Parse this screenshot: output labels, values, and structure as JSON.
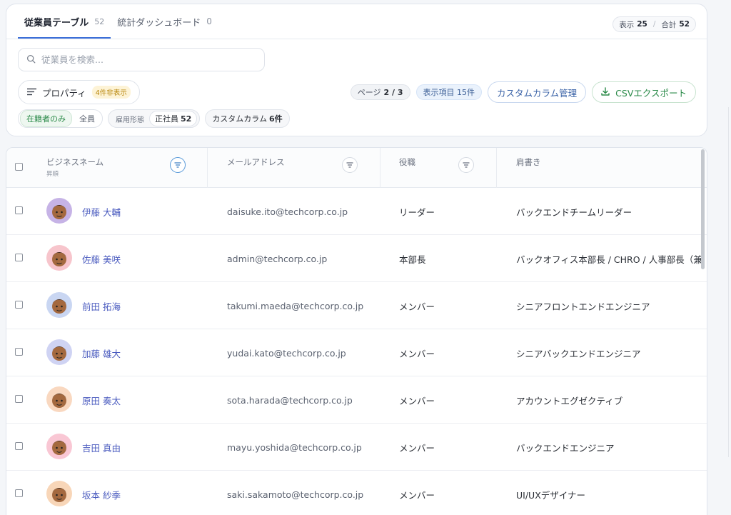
{
  "tabs": [
    {
      "label": "従業員テーブル",
      "count": "52"
    },
    {
      "label": "統計ダッシュボード",
      "count": "0"
    }
  ],
  "summary": {
    "display_label": "表示",
    "display_value": "25",
    "sep": "/",
    "total_label": "合計",
    "total_value": "52"
  },
  "search": {
    "placeholder": "従業員を検索..."
  },
  "properties": {
    "label": "プロパティ",
    "hidden_badge": "4件非表示"
  },
  "pagination": {
    "label": "ページ",
    "value": "2 / 3"
  },
  "columns_chip": "表示項目 15件",
  "custom_column_button": "カスタムカラム管理",
  "csv_button": "CSVエクスポート",
  "filters": {
    "status_options": [
      "在籍者のみ",
      "全員"
    ],
    "employment_label": "雇用形態",
    "employment_value": "正社員",
    "employment_count": "52",
    "custom_column_label": "カスタムカラム",
    "custom_column_count": "6件"
  },
  "table": {
    "headers": {
      "name": "ビジネスネーム",
      "name_sort": "昇順",
      "email": "メールアドレス",
      "role": "役職",
      "title": "肩書き"
    },
    "rows": [
      {
        "name": "伊藤 大輔",
        "email": "daisuke.ito@techcorp.co.jp",
        "role": "リーダー",
        "title": "バックエンドチームリーダー"
      },
      {
        "name": "佐藤 美咲",
        "email": "admin@techcorp.co.jp",
        "role": "本部長",
        "title": "バックオフィス本部長 / CHRO / 人事部長（兼"
      },
      {
        "name": "前田 拓海",
        "email": "takumi.maeda@techcorp.co.jp",
        "role": "メンバー",
        "title": "シニアフロントエンドエンジニア"
      },
      {
        "name": "加藤 雄大",
        "email": "yudai.kato@techcorp.co.jp",
        "role": "メンバー",
        "title": "シニアバックエンドエンジニア"
      },
      {
        "name": "原田 奏太",
        "email": "sota.harada@techcorp.co.jp",
        "role": "メンバー",
        "title": "アカウントエグゼクティブ"
      },
      {
        "name": "吉田 真由",
        "email": "mayu.yoshida@techcorp.co.jp",
        "role": "メンバー",
        "title": "バックエンドエンジニア"
      },
      {
        "name": "坂本 紗季",
        "email": "saki.sakamoto@techcorp.co.jp",
        "role": "メンバー",
        "title": "UI/UXデザイナー"
      }
    ]
  },
  "avatar_colors": [
    "#c6b3e6",
    "#f7c5cc",
    "#c9d6f2",
    "#cfd3f3",
    "#f9d8c0",
    "#f9c7d4",
    "#f8d6b8"
  ],
  "accent_color": "#3c6fd8"
}
